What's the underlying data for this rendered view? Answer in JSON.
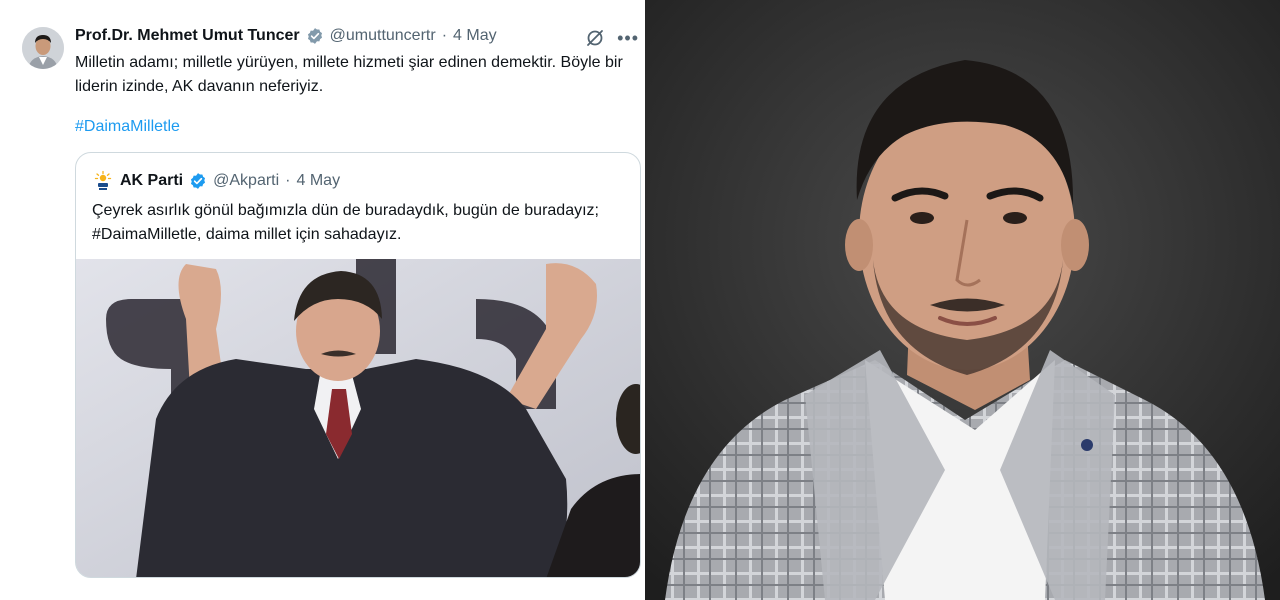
{
  "tweet": {
    "author_name": "Prof.Dr. Mehmet Umut Tuncer",
    "handle": "@umuttuncertr",
    "separator": "·",
    "date": "4 May",
    "text": "Milletin adamı; milletle yürüyen, millete hizmeti şiar edinen demektir. Böyle bir liderin izinde, AK davanın neferiyiz.",
    "hashtag": "#DaimaMilletle",
    "icons": [
      "verified-badge-icon",
      "grok-icon",
      "more-icon"
    ]
  },
  "quote": {
    "author_name": "AK Parti",
    "handle": "@Akparti",
    "separator": "·",
    "date": "4 May",
    "text_line1": "Çeyrek asırlık gönül bağımızla dün de buradaydık, bugün de buradayız;",
    "text_line2": "#DaimaMilletle, daima millet için sahadayız.",
    "icons": [
      "ak-parti-logo-icon",
      "verified-badge-icon"
    ]
  },
  "colors": {
    "accent": "#1d9bf0",
    "text": "#0f1419",
    "muted": "#536471",
    "border": "#cfd9de"
  }
}
